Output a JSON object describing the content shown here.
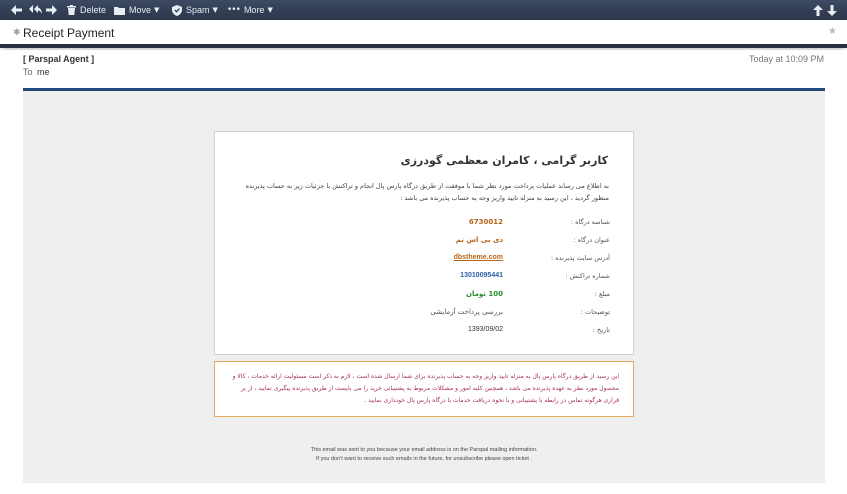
{
  "toolbar": {
    "delete_label": "Delete",
    "move_label": "Move",
    "spam_label": "Spam",
    "more_label": "More"
  },
  "message": {
    "subject": "Receipt Payment",
    "from": "[ Parspal Agent ]",
    "to_label": "To",
    "to": "me",
    "date": "Today at 10:09 PM"
  },
  "receipt": {
    "greeting": "کاربر گرامی ، کامران معظمی گودرزی",
    "intro": "به اطلاع می رساند عملیات پرداخت مورد نظر شما با موفقت از طریق درگاه پارس پال انجام و تراکنش با جزئیات زیر به حساب پذیرنده منظور گردید ، این رسید به منزله تایید واریز وجه به حساب پذیرنده می باشد :",
    "rows": [
      {
        "label": "شناسه درگاه :",
        "value": "6730012",
        "color": "#b4651a"
      },
      {
        "label": "عنوان درگاه :",
        "value": "دی بی اس تم",
        "color": "#b4651a"
      },
      {
        "label": "آدرس سایت پذیرنده :",
        "value": "dbstheme.com",
        "color": "#b4651a"
      },
      {
        "label": "شماره تراکنش :",
        "value": "13010095441",
        "color": "#2b5fa6"
      },
      {
        "label": "مبلغ :",
        "value": "100 تومان",
        "color": "#2e8b2e"
      },
      {
        "label": "توضیحات :",
        "value": "بررسی پرداخت آزمایشی",
        "color": "#555555"
      },
      {
        "label": "تاریخ :",
        "value": "1393/09/02",
        "color": "#333333"
      }
    ]
  },
  "notice": {
    "text": "این رسید از طریق درگاه پارس پال به منزله تایید واریز وجه به حساب پذیرنده برای شما ارسال شده است ، لازم به ذکر است مسئولیت ارائه خدمات ، کالا و محصول مورد نظر به عهده پذیرنده می باشد ، همچنین کلیه امور و مشکلات مربوط به پشتیبانی خرید را می بایست از طریق پذیرنده پیگیری نمایید ، از بر قراری هرگونه تماس در رابطه با پشتیبانی و یا نحوه دریافت خدمات با درگاه پارس پال خودداری نمایید ."
  },
  "footer": {
    "line1": "This email was sent to you because your email address is on the Parspal mailing information.",
    "line2": "If you don't want to receive such emails in the future, for unsubscribe please open ticket ."
  }
}
